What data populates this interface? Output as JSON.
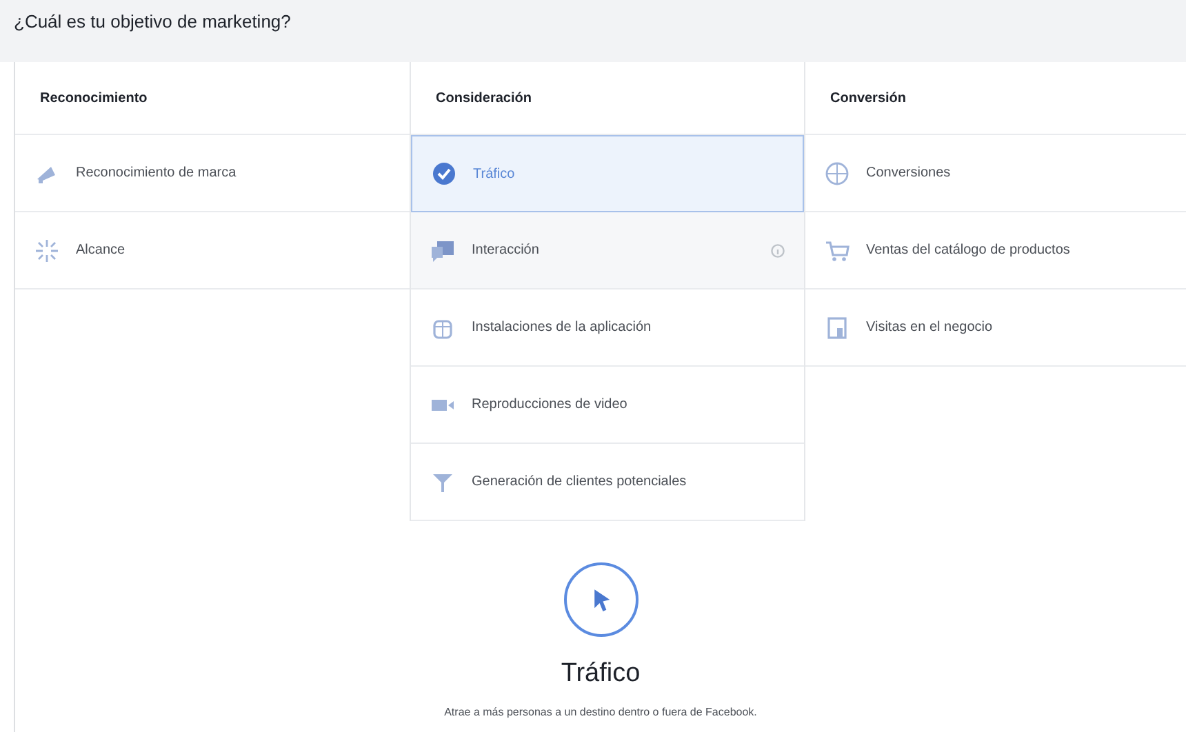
{
  "title": "¿Cuál es tu objetivo de marketing?",
  "columns": [
    {
      "heading": "Reconocimiento",
      "items": [
        {
          "label": "Reconocimiento de marca",
          "kind": "megaphone",
          "selected": false,
          "highlighted": false
        },
        {
          "label": "Alcance",
          "kind": "burst",
          "selected": false,
          "highlighted": false
        }
      ]
    },
    {
      "heading": "Consideración",
      "items": [
        {
          "label": "Tráfico",
          "selected": true,
          "highlighted": false
        },
        {
          "label": "Interacción",
          "kind": "chat",
          "selected": false,
          "highlighted": true
        },
        {
          "label": "Instalaciones de la aplicación",
          "kind": "box",
          "selected": false,
          "highlighted": false
        },
        {
          "label": "Reproducciones de video",
          "kind": "video",
          "selected": false,
          "highlighted": false
        },
        {
          "label": "Generación de clientes potenciales",
          "kind": "funnel",
          "selected": false,
          "highlighted": false
        }
      ]
    },
    {
      "heading": "Conversión",
      "items": [
        {
          "label": "Conversiones",
          "kind": "globe",
          "selected": false,
          "highlighted": false
        },
        {
          "label": "Ventas del catálogo de productos",
          "kind": "cart",
          "selected": false,
          "highlighted": false
        },
        {
          "label": "Visitas en el negocio",
          "kind": "store",
          "selected": false,
          "highlighted": false
        }
      ]
    }
  ],
  "summary": {
    "title": "Tráfico",
    "description": "Atrae a más personas a un destino dentro o fuera de Facebook."
  }
}
